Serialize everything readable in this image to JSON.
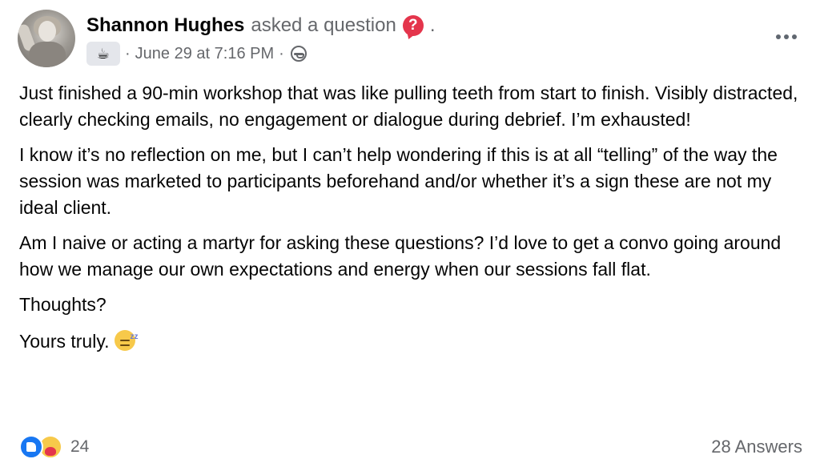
{
  "post": {
    "author": "Shannon Hughes",
    "action": "asked a question",
    "question_badge": "?",
    "trailing_dot": ".",
    "date": "June 29 at 7:16 PM",
    "separator": "·",
    "group_badge_icon": "coffee-cup-icon",
    "audience_icon": "group-audience-icon",
    "paragraphs": [
      "Just finished a 90-min workshop that was like pulling teeth from start to finish. Visibly distracted, clearly checking emails, no engagement or dialogue during debrief. I’m exhausted!",
      "I know it’s no reflection on me, but I can’t help wondering if this is at all “telling” of the way the session was marketed to participants beforehand and/or whether it’s a sign these are not my ideal client.",
      "Am I naive or acting a martyr for asking these questions?  I’d love to get a convo going around how we manage our own expectations and energy when our sessions fall flat.",
      "Thoughts?",
      "Yours truly."
    ]
  },
  "footer": {
    "reaction_count": "24",
    "answers": "28 Answers",
    "reaction_icons": [
      "like-icon",
      "care-icon"
    ]
  },
  "colors": {
    "text_primary": "#050505",
    "text_secondary": "#65676b",
    "like_blue": "#1877f2",
    "question_red": "#e4354c"
  }
}
